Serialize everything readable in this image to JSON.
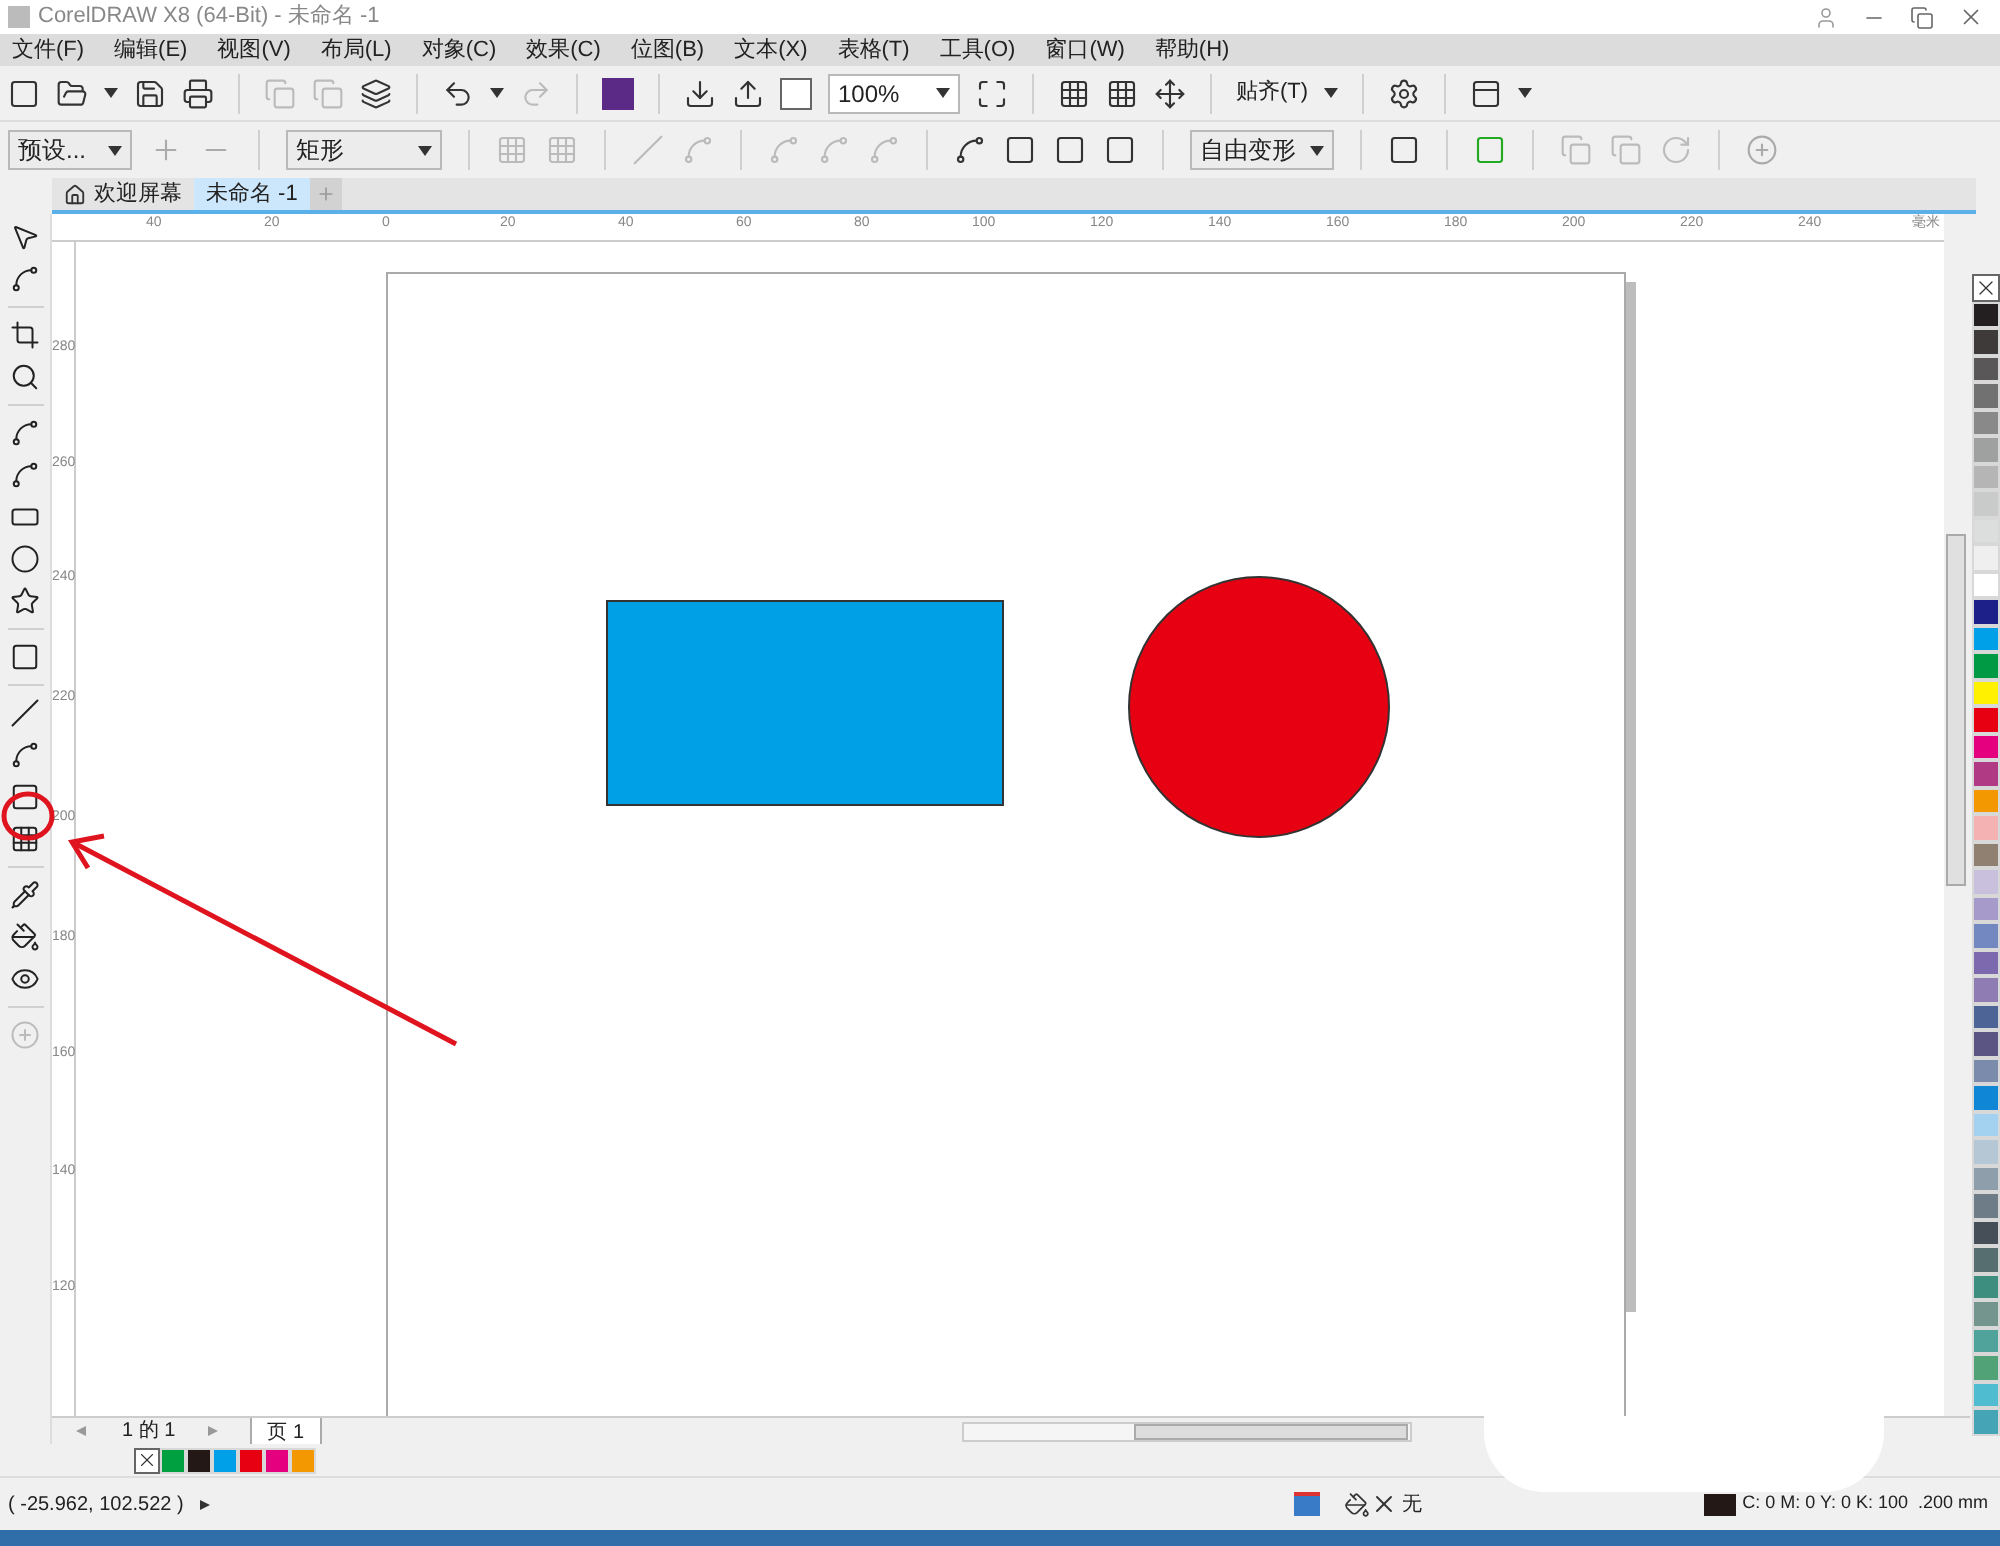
{
  "title_bar": {
    "title": "CorelDRAW X8 (64-Bit) - 未命名 -1"
  },
  "menu": [
    "文件(F)",
    "编辑(E)",
    "视图(V)",
    "布局(L)",
    "对象(C)",
    "效果(C)",
    "位图(B)",
    "文本(X)",
    "表格(T)",
    "工具(O)",
    "窗口(W)",
    "帮助(H)"
  ],
  "standard_toolbar": {
    "zoom": "100%",
    "snap": "贴齐(T)"
  },
  "property_bar": {
    "preset": "预设...",
    "shape": "矩形",
    "transform": "自由变形"
  },
  "doc_tabs": [
    {
      "label": "欢迎屏幕",
      "selected": false
    },
    {
      "label": "未命名 -1",
      "selected": true
    }
  ],
  "ruler": {
    "h_labels": [
      "40",
      "20",
      "0",
      "20",
      "40",
      "60",
      "80",
      "100",
      "120",
      "140",
      "160",
      "180",
      "200",
      "220",
      "240"
    ],
    "unit": "毫米",
    "v_labels": [
      "280",
      "260",
      "240",
      "220",
      "200",
      "180",
      "160",
      "140",
      "120"
    ]
  },
  "shapes": [
    {
      "kind": "rectangle",
      "color": "#00a0e6"
    },
    {
      "kind": "ellipse",
      "color": "#e60012"
    }
  ],
  "page_nav": {
    "current": "1",
    "of": "的",
    "total": "1",
    "page_tab": "页 1"
  },
  "document_palette": [
    {
      "kind": "none"
    },
    {
      "kind": "swatch",
      "color": "#00a040"
    },
    {
      "kind": "swatch",
      "color": "#231815"
    },
    {
      "kind": "swatch",
      "color": "#00a0e9"
    },
    {
      "kind": "swatch",
      "color": "#e60012"
    },
    {
      "kind": "swatch",
      "color": "#e4007f"
    },
    {
      "kind": "swatch",
      "color": "#f39800"
    }
  ],
  "status_bar": {
    "coords": "( -25.962, 102.522 )",
    "fill": "无",
    "outline": "C: 0 M: 0 Y: 0 K: 100  .200 mm"
  },
  "color_palette": [
    {
      "kind": "none"
    },
    {
      "kind": "swatch",
      "color": "#231f20"
    },
    {
      "kind": "swatch",
      "color": "#3e3a39"
    },
    {
      "kind": "swatch",
      "color": "#595757"
    },
    {
      "kind": "swatch",
      "color": "#727171"
    },
    {
      "kind": "swatch",
      "color": "#898989"
    },
    {
      "kind": "swatch",
      "color": "#9fa0a0"
    },
    {
      "kind": "swatch",
      "color": "#b5b5b6"
    },
    {
      "kind": "swatch",
      "color": "#c9caca"
    },
    {
      "kind": "swatch",
      "color": "#dcdddd"
    },
    {
      "kind": "swatch",
      "color": "#efefef"
    },
    {
      "kind": "swatch",
      "color": "#ffffff"
    },
    {
      "kind": "swatch",
      "color": "#1d2088"
    },
    {
      "kind": "swatch",
      "color": "#00a0e9"
    },
    {
      "kind": "swatch",
      "color": "#009944"
    },
    {
      "kind": "swatch",
      "color": "#fff100"
    },
    {
      "kind": "swatch",
      "color": "#e60012"
    },
    {
      "kind": "swatch",
      "color": "#e4007f"
    },
    {
      "kind": "swatch",
      "color": "#b03a84"
    },
    {
      "kind": "swatch",
      "color": "#f39800"
    },
    {
      "kind": "swatch",
      "color": "#f5b2b2"
    },
    {
      "kind": "swatch",
      "color": "#8f8071"
    },
    {
      "kind": "swatch",
      "color": "#c9c0dd"
    },
    {
      "kind": "swatch",
      "color": "#a59aca"
    },
    {
      "kind": "swatch",
      "color": "#7388c1"
    },
    {
      "kind": "swatch",
      "color": "#7d69ad"
    },
    {
      "kind": "swatch",
      "color": "#8e7cb3"
    },
    {
      "kind": "swatch",
      "color": "#4d6497"
    },
    {
      "kind": "swatch",
      "color": "#5b5583"
    },
    {
      "kind": "swatch",
      "color": "#7a8bab"
    },
    {
      "kind": "swatch",
      "color": "#0f87d6"
    },
    {
      "kind": "swatch",
      "color": "#a3d2f0"
    },
    {
      "kind": "swatch",
      "color": "#b5c7d5"
    },
    {
      "kind": "swatch",
      "color": "#8e9eaa"
    },
    {
      "kind": "swatch",
      "color": "#6e7c88"
    },
    {
      "kind": "swatch",
      "color": "#464e57"
    },
    {
      "kind": "swatch",
      "color": "#566e70"
    },
    {
      "kind": "swatch",
      "color": "#3e8e80"
    },
    {
      "kind": "swatch",
      "color": "#74958e"
    },
    {
      "kind": "swatch",
      "color": "#4fa39a"
    },
    {
      "kind": "swatch",
      "color": "#52a277"
    },
    {
      "kind": "swatch",
      "color": "#4fbcd0"
    },
    {
      "kind": "swatch",
      "color": "#45a4b5"
    }
  ]
}
